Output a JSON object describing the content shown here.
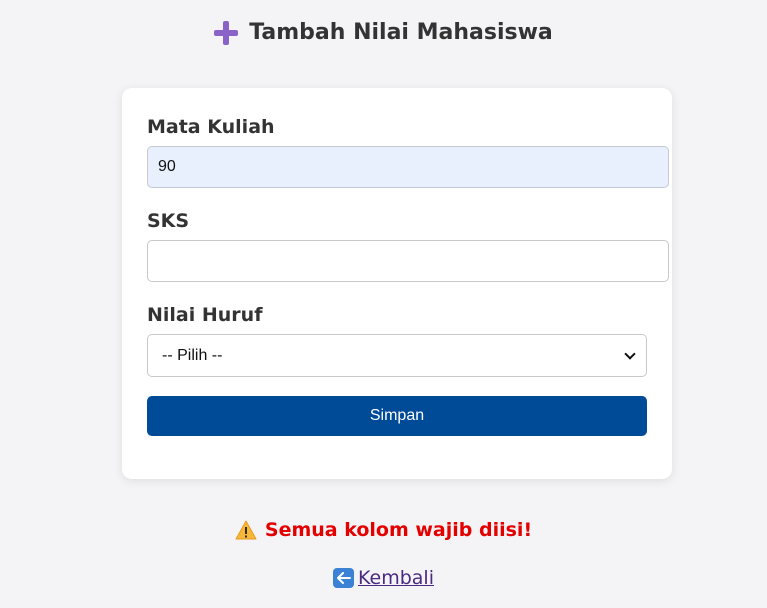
{
  "page": {
    "title": "Tambah Nilai Mahasiswa",
    "title_icon": "plus-icon"
  },
  "form": {
    "mata_kuliah": {
      "label": "Mata Kuliah",
      "value": "90"
    },
    "sks": {
      "label": "SKS",
      "value": ""
    },
    "nilai_huruf": {
      "label": "Nilai Huruf",
      "selected": "-- Pilih --"
    },
    "submit_label": "Simpan"
  },
  "message": {
    "icon": "warning-icon",
    "text": "Semua kolom wajib diisi!",
    "color": "#e50000"
  },
  "back_link": {
    "icon": "left-arrow-icon",
    "label": "Kembali"
  },
  "colors": {
    "accent": "#004b97",
    "title_icon": "#8a63c8",
    "link": "#4b2a82",
    "autofill_bg": "#e8f0fe"
  }
}
